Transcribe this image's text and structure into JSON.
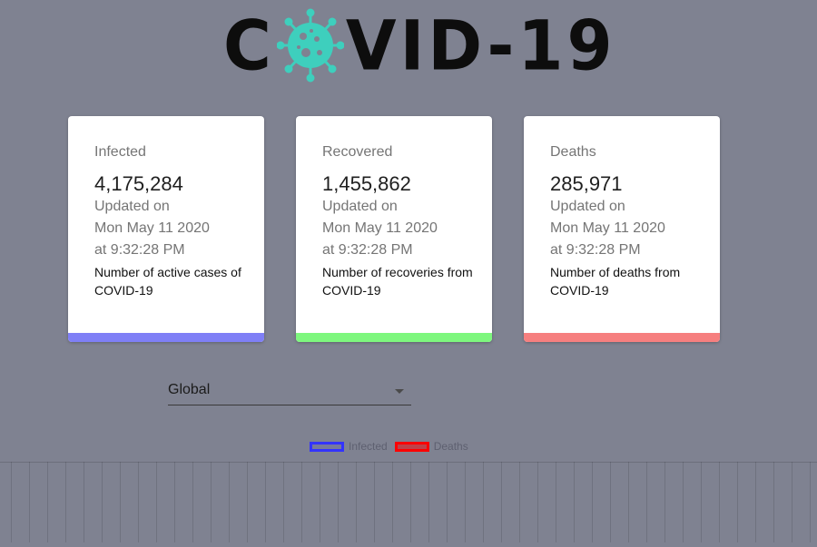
{
  "logo": {
    "text_left": "C",
    "text_right": "VID-19",
    "virus_icon": "virus-icon",
    "virus_color": "#3ecfbd"
  },
  "cards": [
    {
      "title": "Infected",
      "value": "4,175,284",
      "updated_label": "Updated on",
      "date": "Mon May 11 2020",
      "time": "at 9:32:28 PM",
      "description": "Number of active cases of COVID-19",
      "accent": "#7f7ff6"
    },
    {
      "title": "Recovered",
      "value": "1,455,862",
      "updated_label": "Updated on",
      "date": "Mon May 11 2020",
      "time": "at 9:32:28 PM",
      "description": "Number of recoveries from COVID-19",
      "accent": "#7ef77e"
    },
    {
      "title": "Deaths",
      "value": "285,971",
      "updated_label": "Updated on",
      "date": "Mon May 11 2020",
      "time": "at 9:32:28 PM",
      "description": "Number of deaths from COVID-19",
      "accent": "#f67f7f"
    }
  ],
  "country_select": {
    "selected": "Global",
    "arrow_icon": "arrow-drop-down-icon"
  },
  "chart_legend": [
    {
      "label": "Infected",
      "border": "#3333ff",
      "fill": "rgba(51,51,255,0.1)"
    },
    {
      "label": "Deaths",
      "border": "#ff0000",
      "fill": "rgba(255,0,0,0.5)"
    }
  ],
  "chart_data": {
    "type": "line",
    "series": [
      {
        "name": "Infected",
        "values": []
      },
      {
        "name": "Deaths",
        "values": []
      }
    ],
    "grid": true
  }
}
